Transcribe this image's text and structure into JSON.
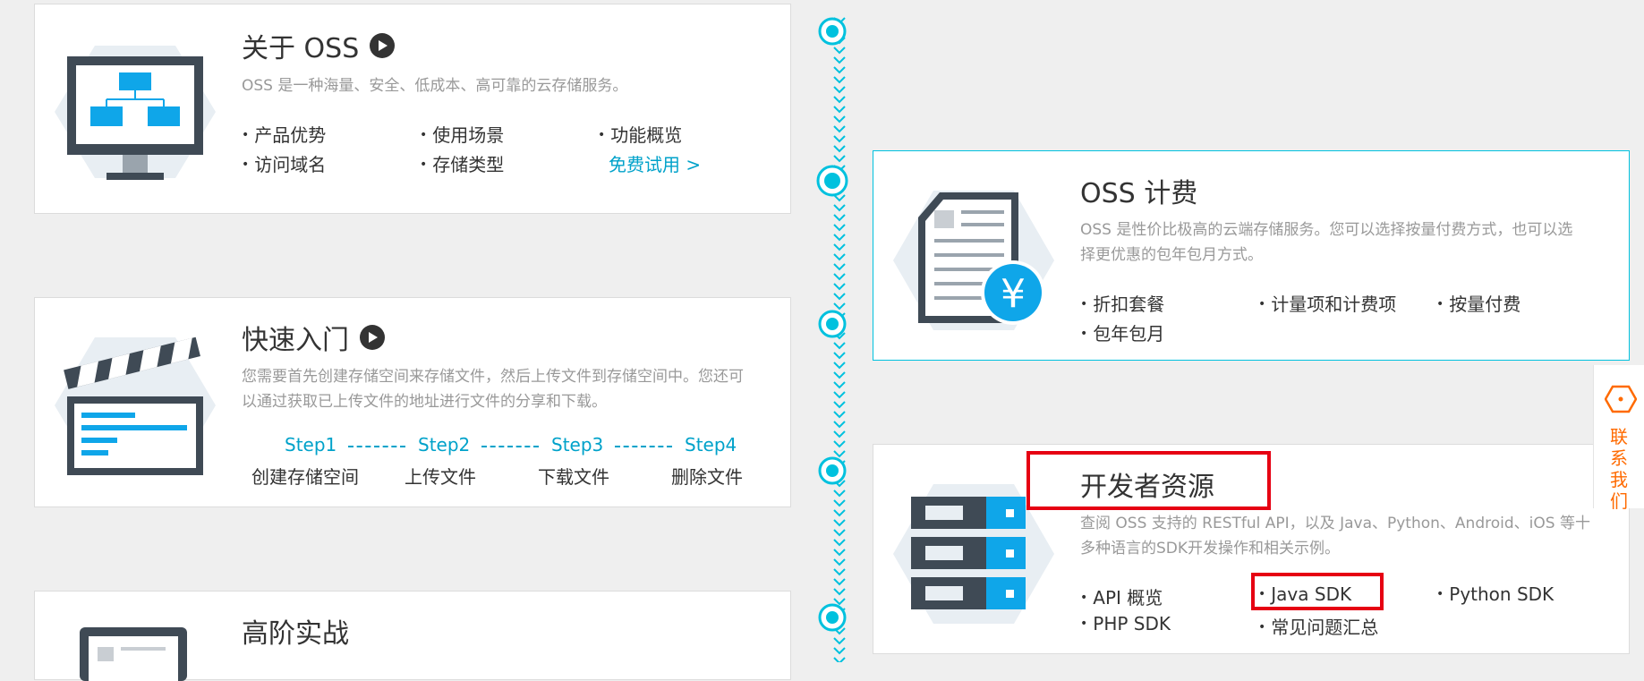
{
  "cards": {
    "about": {
      "title": "关于 OSS",
      "desc": "OSS 是一种海量、安全、低成本、高可靠的云存储服务。",
      "links": [
        "产品优势",
        "使用场景",
        "功能概览",
        "访问域名",
        "存储类型"
      ],
      "cta": "免费试用 >"
    },
    "quickstart": {
      "title": "快速入门",
      "desc_line1": "您需要首先创建存储空间来存储文件，然后上传文件到存储空间中。您还可",
      "desc_line2": "以通过获取已上传文件的地址进行文件的分享和下载。",
      "steps": [
        {
          "label": "Step1",
          "desc": "创建存储空间"
        },
        {
          "label": "Step2",
          "desc": "上传文件"
        },
        {
          "label": "Step3",
          "desc": "下载文件"
        },
        {
          "label": "Step4",
          "desc": "删除文件"
        }
      ]
    },
    "advanced": {
      "title": "高阶实战"
    },
    "billing": {
      "title": "OSS 计费",
      "desc_line1": "OSS 是性价比极高的云端存储服务。您可以选择按量付费方式，也可以选",
      "desc_line2": "择更优惠的包年包月方式。",
      "links": [
        "折扣套餐",
        "计量项和计费项",
        "按量付费",
        "包年包月"
      ]
    },
    "developer": {
      "title": "开发者资源",
      "desc_line1": "查阅 OSS 支持的 RESTful API，以及 Java、Python、Android、iOS 等十",
      "desc_line2": "多种语言的SDK开发操作和相关示例。",
      "links": [
        "API 概览",
        "Java SDK",
        "Python SDK",
        "PHP SDK",
        "常见问题汇总"
      ]
    }
  },
  "contact": {
    "label": "联系我们"
  },
  "colors": {
    "accent": "#00c1de",
    "link": "#00a2ca",
    "highlight": "#e60012",
    "contact": "#ff6a00"
  }
}
